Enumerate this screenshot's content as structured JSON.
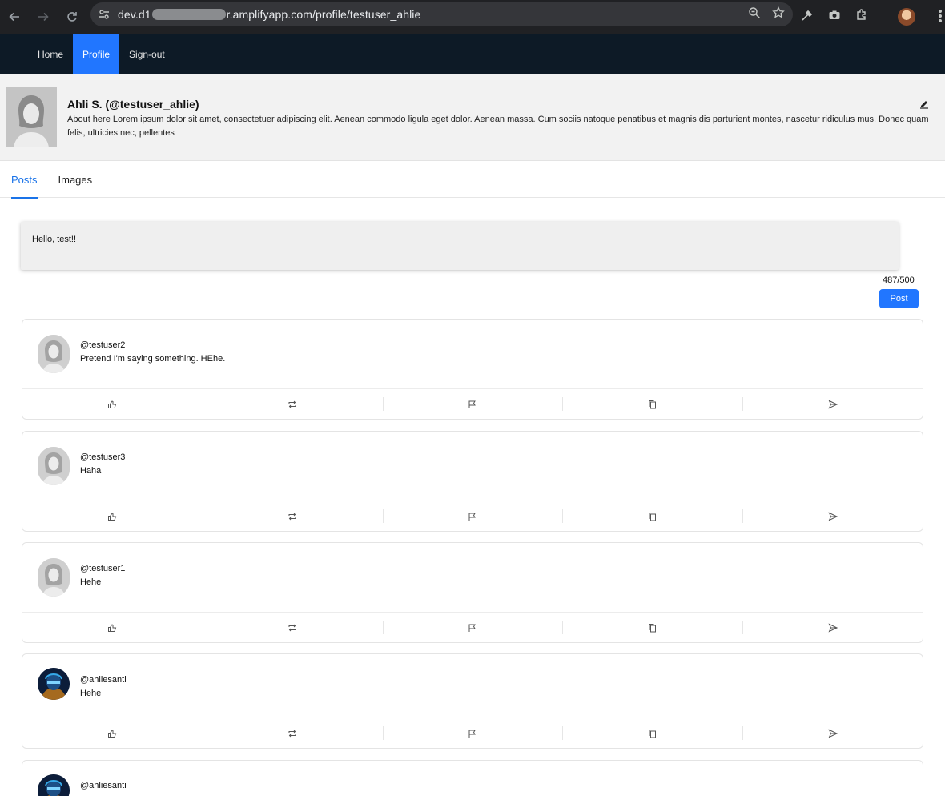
{
  "browser": {
    "url_prefix": "dev.d1",
    "url_suffix": "r.amplifyapp.com/profile/testuser_ahlie"
  },
  "nav": {
    "items": [
      {
        "label": "Home",
        "active": false
      },
      {
        "label": "Profile",
        "active": true
      },
      {
        "label": "Sign-out",
        "active": false
      }
    ]
  },
  "profile": {
    "name": "Ahli S. (@testuser_ahlie)",
    "about": "About here Lorem ipsum dolor sit amet, consectetuer adipiscing elit. Aenean commodo ligula eget dolor. Aenean massa. Cum sociis natoque penatibus et magnis dis parturient montes, nascetur ridiculus mus. Donec quam felis, ultricies nec, pellentes"
  },
  "tabs": [
    {
      "label": "Posts",
      "active": true
    },
    {
      "label": "Images",
      "active": false
    }
  ],
  "composer": {
    "value": "Hello, test!!",
    "char_count": "487/500",
    "post_label": "Post"
  },
  "posts": [
    {
      "username": "@testuser2",
      "text": "Pretend I'm saying something. HEhe.",
      "avatar": "default-avatar"
    },
    {
      "username": "@testuser3",
      "text": "Haha",
      "avatar": "default-avatar"
    },
    {
      "username": "@testuser1",
      "text": "Hehe",
      "avatar": "default-avatar"
    },
    {
      "username": "@ahliesanti",
      "text": "Hehe",
      "avatar": "custom-avatar"
    },
    {
      "username": "@ahliesanti",
      "text": "",
      "avatar": "custom-avatar"
    }
  ],
  "post_actions": [
    "like-icon",
    "repost-icon",
    "flag-icon",
    "copy-icon",
    "send-icon"
  ]
}
